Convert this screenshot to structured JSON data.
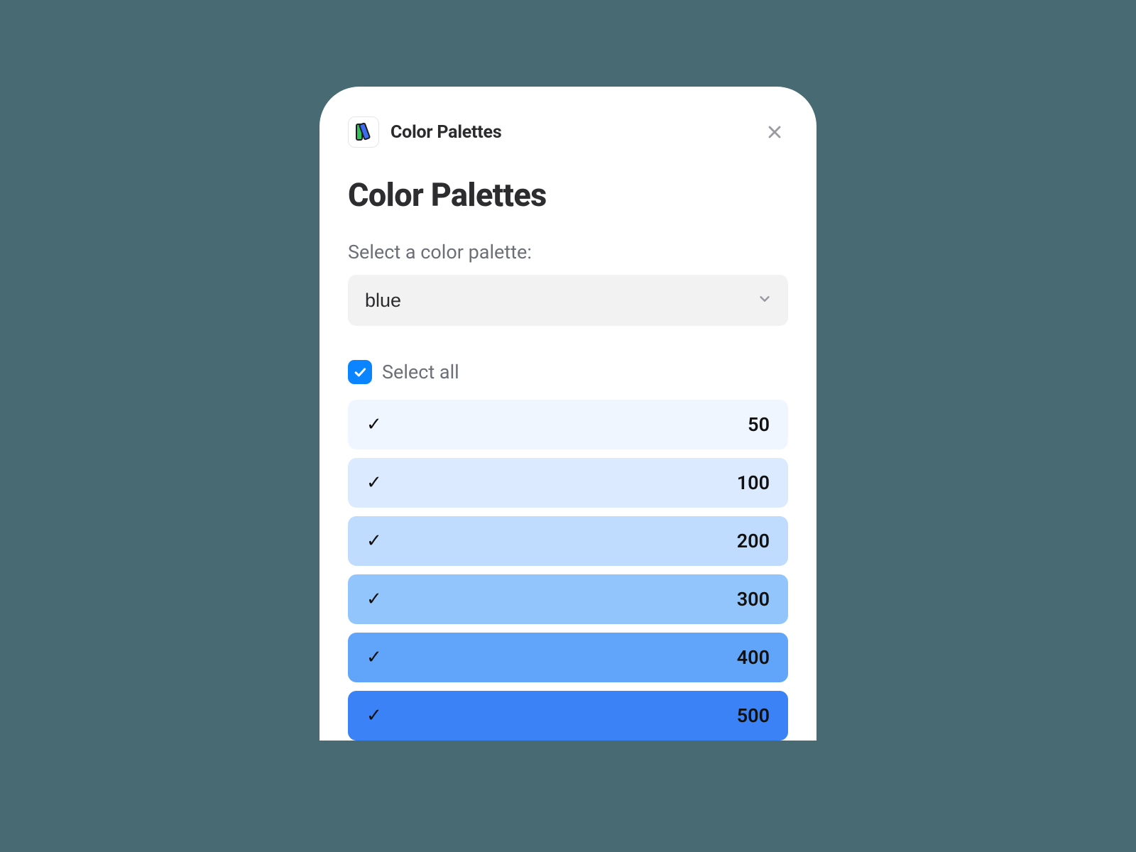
{
  "header": {
    "title": "Color Palettes"
  },
  "page": {
    "title": "Color Palettes",
    "selectLabel": "Select a color palette:",
    "selectValue": "blue",
    "selectAllLabel": "Select all",
    "selectAllChecked": true
  },
  "swatches": [
    {
      "label": "50",
      "hex": "#eff6ff",
      "textColor": "#111111",
      "checked": true
    },
    {
      "label": "100",
      "hex": "#dbeafe",
      "textColor": "#111111",
      "checked": true
    },
    {
      "label": "200",
      "hex": "#bfdbfe",
      "textColor": "#111111",
      "checked": true
    },
    {
      "label": "300",
      "hex": "#93c5fd",
      "textColor": "#111111",
      "checked": true
    },
    {
      "label": "400",
      "hex": "#60a5fa",
      "textColor": "#111111",
      "checked": true
    },
    {
      "label": "500",
      "hex": "#3b82f6",
      "textColor": "#111111",
      "checked": true
    }
  ]
}
